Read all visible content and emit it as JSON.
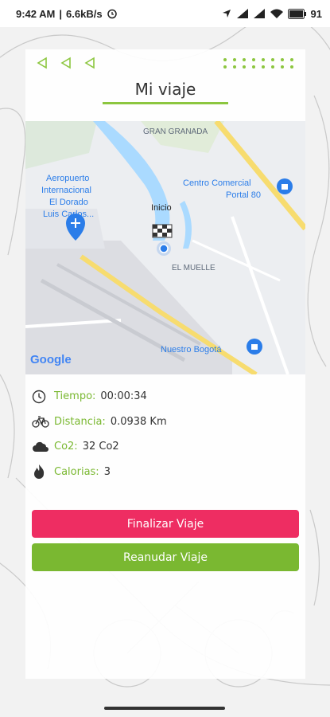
{
  "status_bar": {
    "time": "9:42 AM",
    "speed": "6.6kB/s",
    "battery": "91"
  },
  "header": {
    "title": "Mi viaje",
    "icons": [
      "back-arrow-icon",
      "back-arrow-icon",
      "back-arrow-icon",
      "dots-grid-icon"
    ]
  },
  "map": {
    "labels": {
      "gran_granada": "GRAN GRANADA",
      "airport_1": "Aeropuerto",
      "airport_2": "Internacional",
      "airport_3": "El Dorado",
      "airport_4": "Luis Carlos...",
      "inicio": "Inicio",
      "mall_1": "Centro Comercial",
      "mall_2": "Portal 80",
      "el_muelle": "EL MUELLE",
      "nuestro_bogota": "Nuestro Bogotá",
      "google": "Google"
    }
  },
  "stats": [
    {
      "label": "Tiempo:",
      "value": "00:00:34",
      "icon": "clock-icon"
    },
    {
      "label": "Distancia:",
      "value": "0.0938 Km",
      "icon": "bicycle-icon"
    },
    {
      "label": "Co2:",
      "value": "32 Co2",
      "icon": "co2-cloud-icon"
    },
    {
      "label": "Calorias:",
      "value": "3",
      "icon": "flame-icon"
    }
  ],
  "buttons": {
    "finish": "Finalizar Viaje",
    "resume": "Reanudar Viaje"
  },
  "colors": {
    "accent_green": "#7ab831",
    "finish_red": "#ee2d62",
    "map_water": "#aadaff",
    "map_road_major": "#f7dc6f"
  }
}
